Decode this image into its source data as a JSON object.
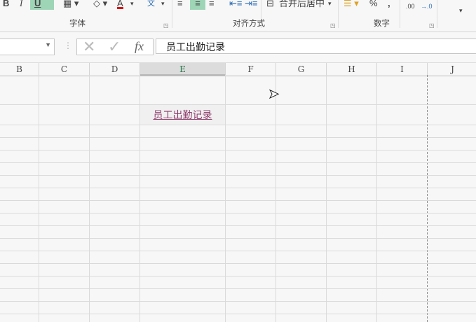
{
  "ribbon": {
    "bold": "B",
    "italic": "I",
    "underline": "U",
    "font_color": "A",
    "wen": "文",
    "merge_center": "合并后居中",
    "percent": "%",
    "comma": ",",
    "inc_dec": ".00",
    "groups": {
      "font": "字体",
      "alignment": "对齐方式",
      "number": "数字"
    }
  },
  "formula_bar": {
    "fx": "fx",
    "value": "员工出勤记录"
  },
  "columns": [
    "B",
    "C",
    "D",
    "E",
    "F",
    "G",
    "H",
    "I",
    "J"
  ],
  "selected_column": "E",
  "cells": {
    "E2": "员工出勤记录"
  },
  "colors": {
    "link": "#8e3d6b",
    "highlight": "#9fd5b7",
    "font_red": "#e00000"
  }
}
